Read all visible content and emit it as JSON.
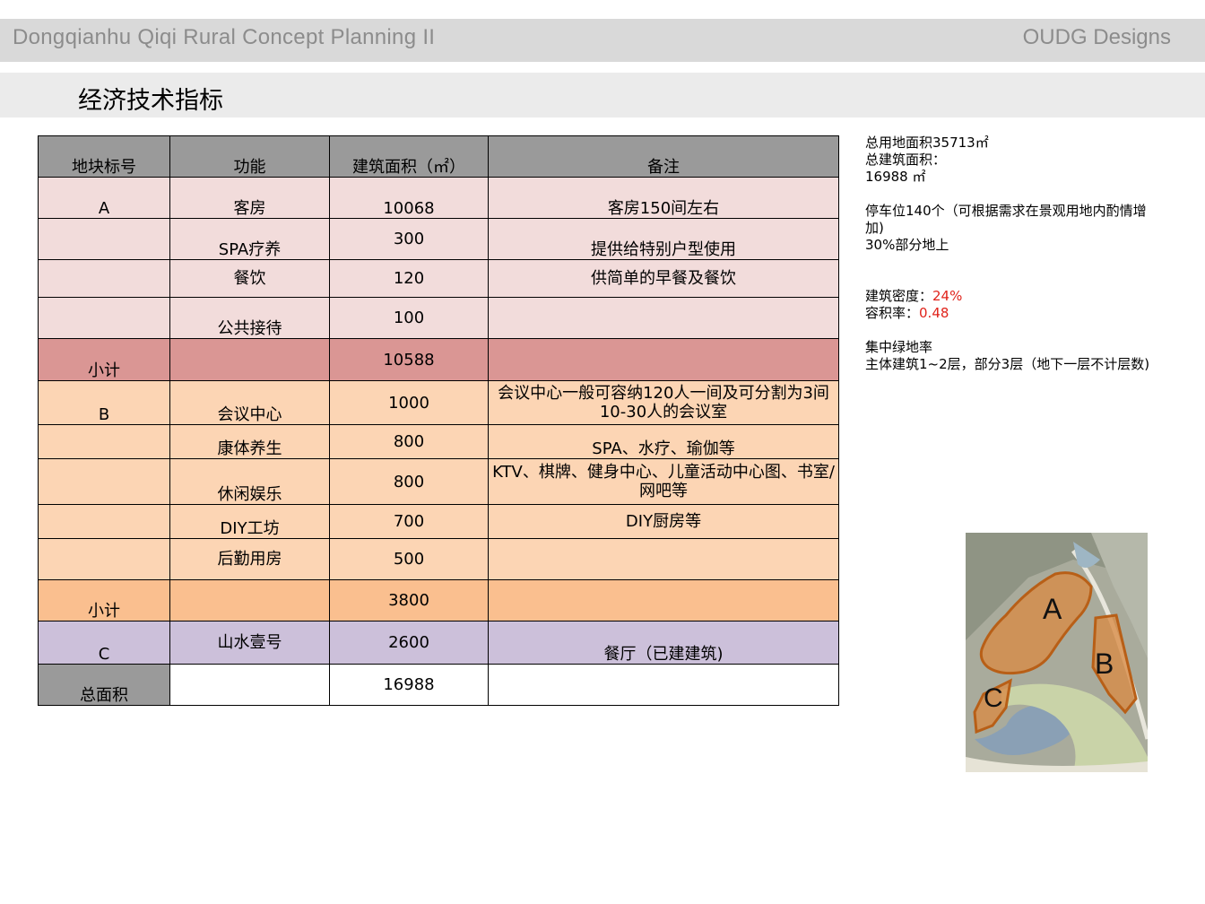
{
  "header": {
    "project_title": "Dongqianhu Qiqi Rural Concept Planning II",
    "brand": "OUDG Designs"
  },
  "page_title": "经济技术指标",
  "table": {
    "headers": [
      "地块标号",
      "功能",
      "建筑面积（㎡）",
      "备注"
    ],
    "rows": [
      {
        "plot": "A",
        "func": "客房",
        "area": "10068",
        "note": "客房150间左右"
      },
      {
        "plot": "",
        "func": "SPA疗养",
        "area": "300",
        "note": "提供给特别户型使用"
      },
      {
        "plot": "",
        "func": "餐饮",
        "area": "120",
        "note": "供简单的早餐及餐饮"
      },
      {
        "plot": "",
        "func": "公共接待",
        "area": "100",
        "note": ""
      },
      {
        "plot": "小计",
        "func": "",
        "area": "10588",
        "note": ""
      },
      {
        "plot": "B",
        "func": "会议中心",
        "area": "1000",
        "note": "会议中心一般可容纳120人一间及可分割为3间10-30人的会议室"
      },
      {
        "plot": "",
        "func": "康体养生",
        "area": "800",
        "note": "SPA、水疗、瑜伽等"
      },
      {
        "plot": "",
        "func": "休闲娱乐",
        "area": "800",
        "note": "KTV、棋牌、健身中心、儿童活动中心图、书室/网吧等"
      },
      {
        "plot": "",
        "func": "DIY工坊",
        "area": "700",
        "note": "DIY厨房等"
      },
      {
        "plot": "",
        "func": "后勤用房",
        "area": "500",
        "note": ""
      },
      {
        "plot": "小计",
        "func": "",
        "area": "3800",
        "note": ""
      },
      {
        "plot": "C",
        "func": "山水壹号",
        "area": "2600",
        "note": "餐厅（已建建筑)"
      },
      {
        "plot": "总面积",
        "func": "",
        "area": "16988",
        "note": ""
      }
    ]
  },
  "info": {
    "total_land": "总用地面积35713㎡",
    "total_building_label": "总建筑面积：",
    "total_building_value": "16988 ㎡",
    "parking": "停车位140个（可根据需求在景观用地内酌情增加)",
    "parking_ground": "30%部分地上",
    "density_label": "建筑密度：",
    "density_value": "24%",
    "far_label": "容积率：",
    "far_value": "0.48",
    "green_label": "集中绿地率",
    "floors": "主体建筑1~2层，部分3层（地下一层不计层数)"
  },
  "map": {
    "label_a": "A",
    "label_b": "B",
    "label_c": "C"
  },
  "colors": {
    "header_gray": "#9a9a9a",
    "plot_a": "#f2dcdb",
    "plot_a_subtotal": "#da9694",
    "plot_b": "#fcd5b4",
    "plot_b_subtotal": "#fabf8f",
    "plot_c": "#ccc0da",
    "highlight_red": "#e0231b"
  }
}
